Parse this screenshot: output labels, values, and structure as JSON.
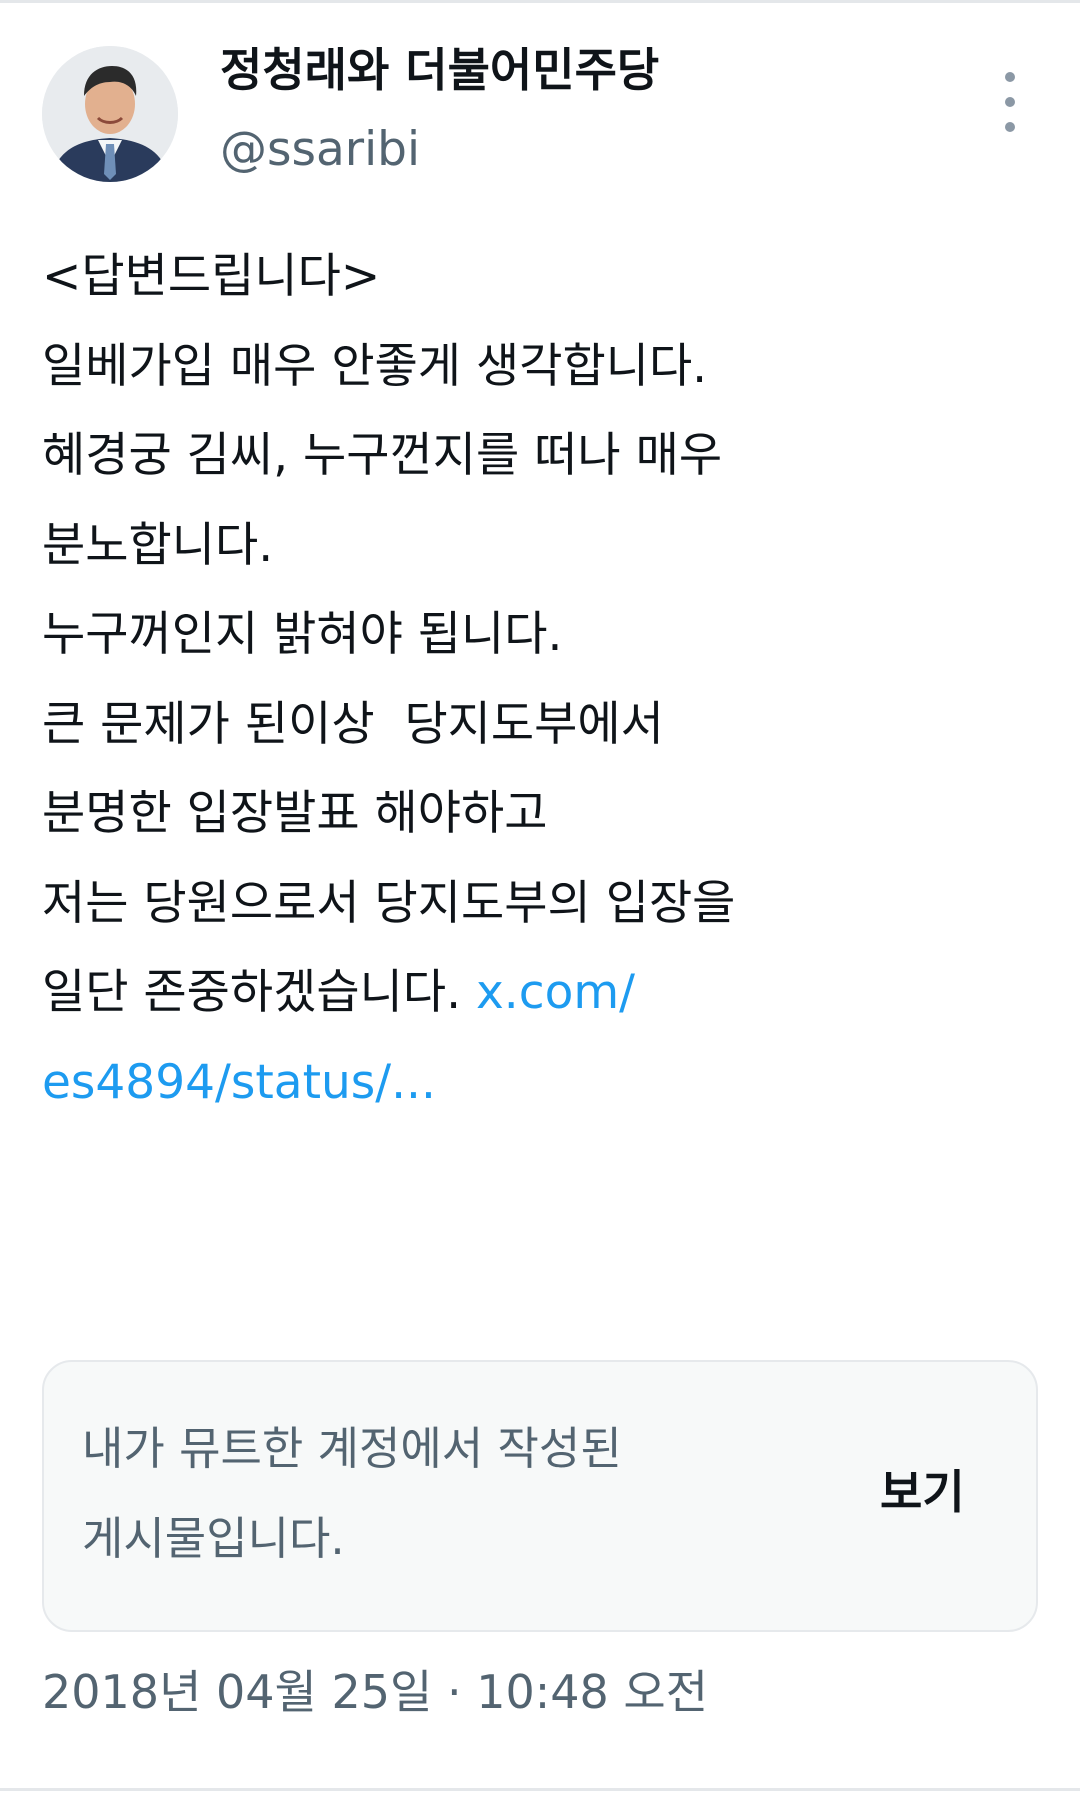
{
  "author": {
    "name": "정청래와 더불어민주당",
    "handle": "@ssaribi"
  },
  "tweet": {
    "lines": [
      "<답변드립니다>",
      "일베가입 매우 안좋게 생각합니다.",
      "혜경궁 김씨, 누구껀지를 떠나 매우",
      "분노합니다.",
      "누구꺼인지 밝혀야 됩니다.",
      "큰 문제가 된이상  당지도부에서",
      "분명한 입장발표 해야하고",
      "저는 당원으로서 당지도부의 입장을"
    ],
    "last_line_text": "일단 존중하겠습니다. ",
    "link_part1": "x.com/",
    "link_part2": "es4894/status/..."
  },
  "muted_notice": {
    "line1": "내가 뮤트한 계정에서 작성된",
    "line2": "게시물입니다.",
    "view_label": "보기"
  },
  "timestamp": "2018년 04월 25일 · 10:48 오전",
  "colors": {
    "link": "#1d9bf0",
    "secondary_text": "#536471",
    "card_background": "#f7f9f9"
  },
  "icons": {
    "more": "more-vertical-icon"
  }
}
